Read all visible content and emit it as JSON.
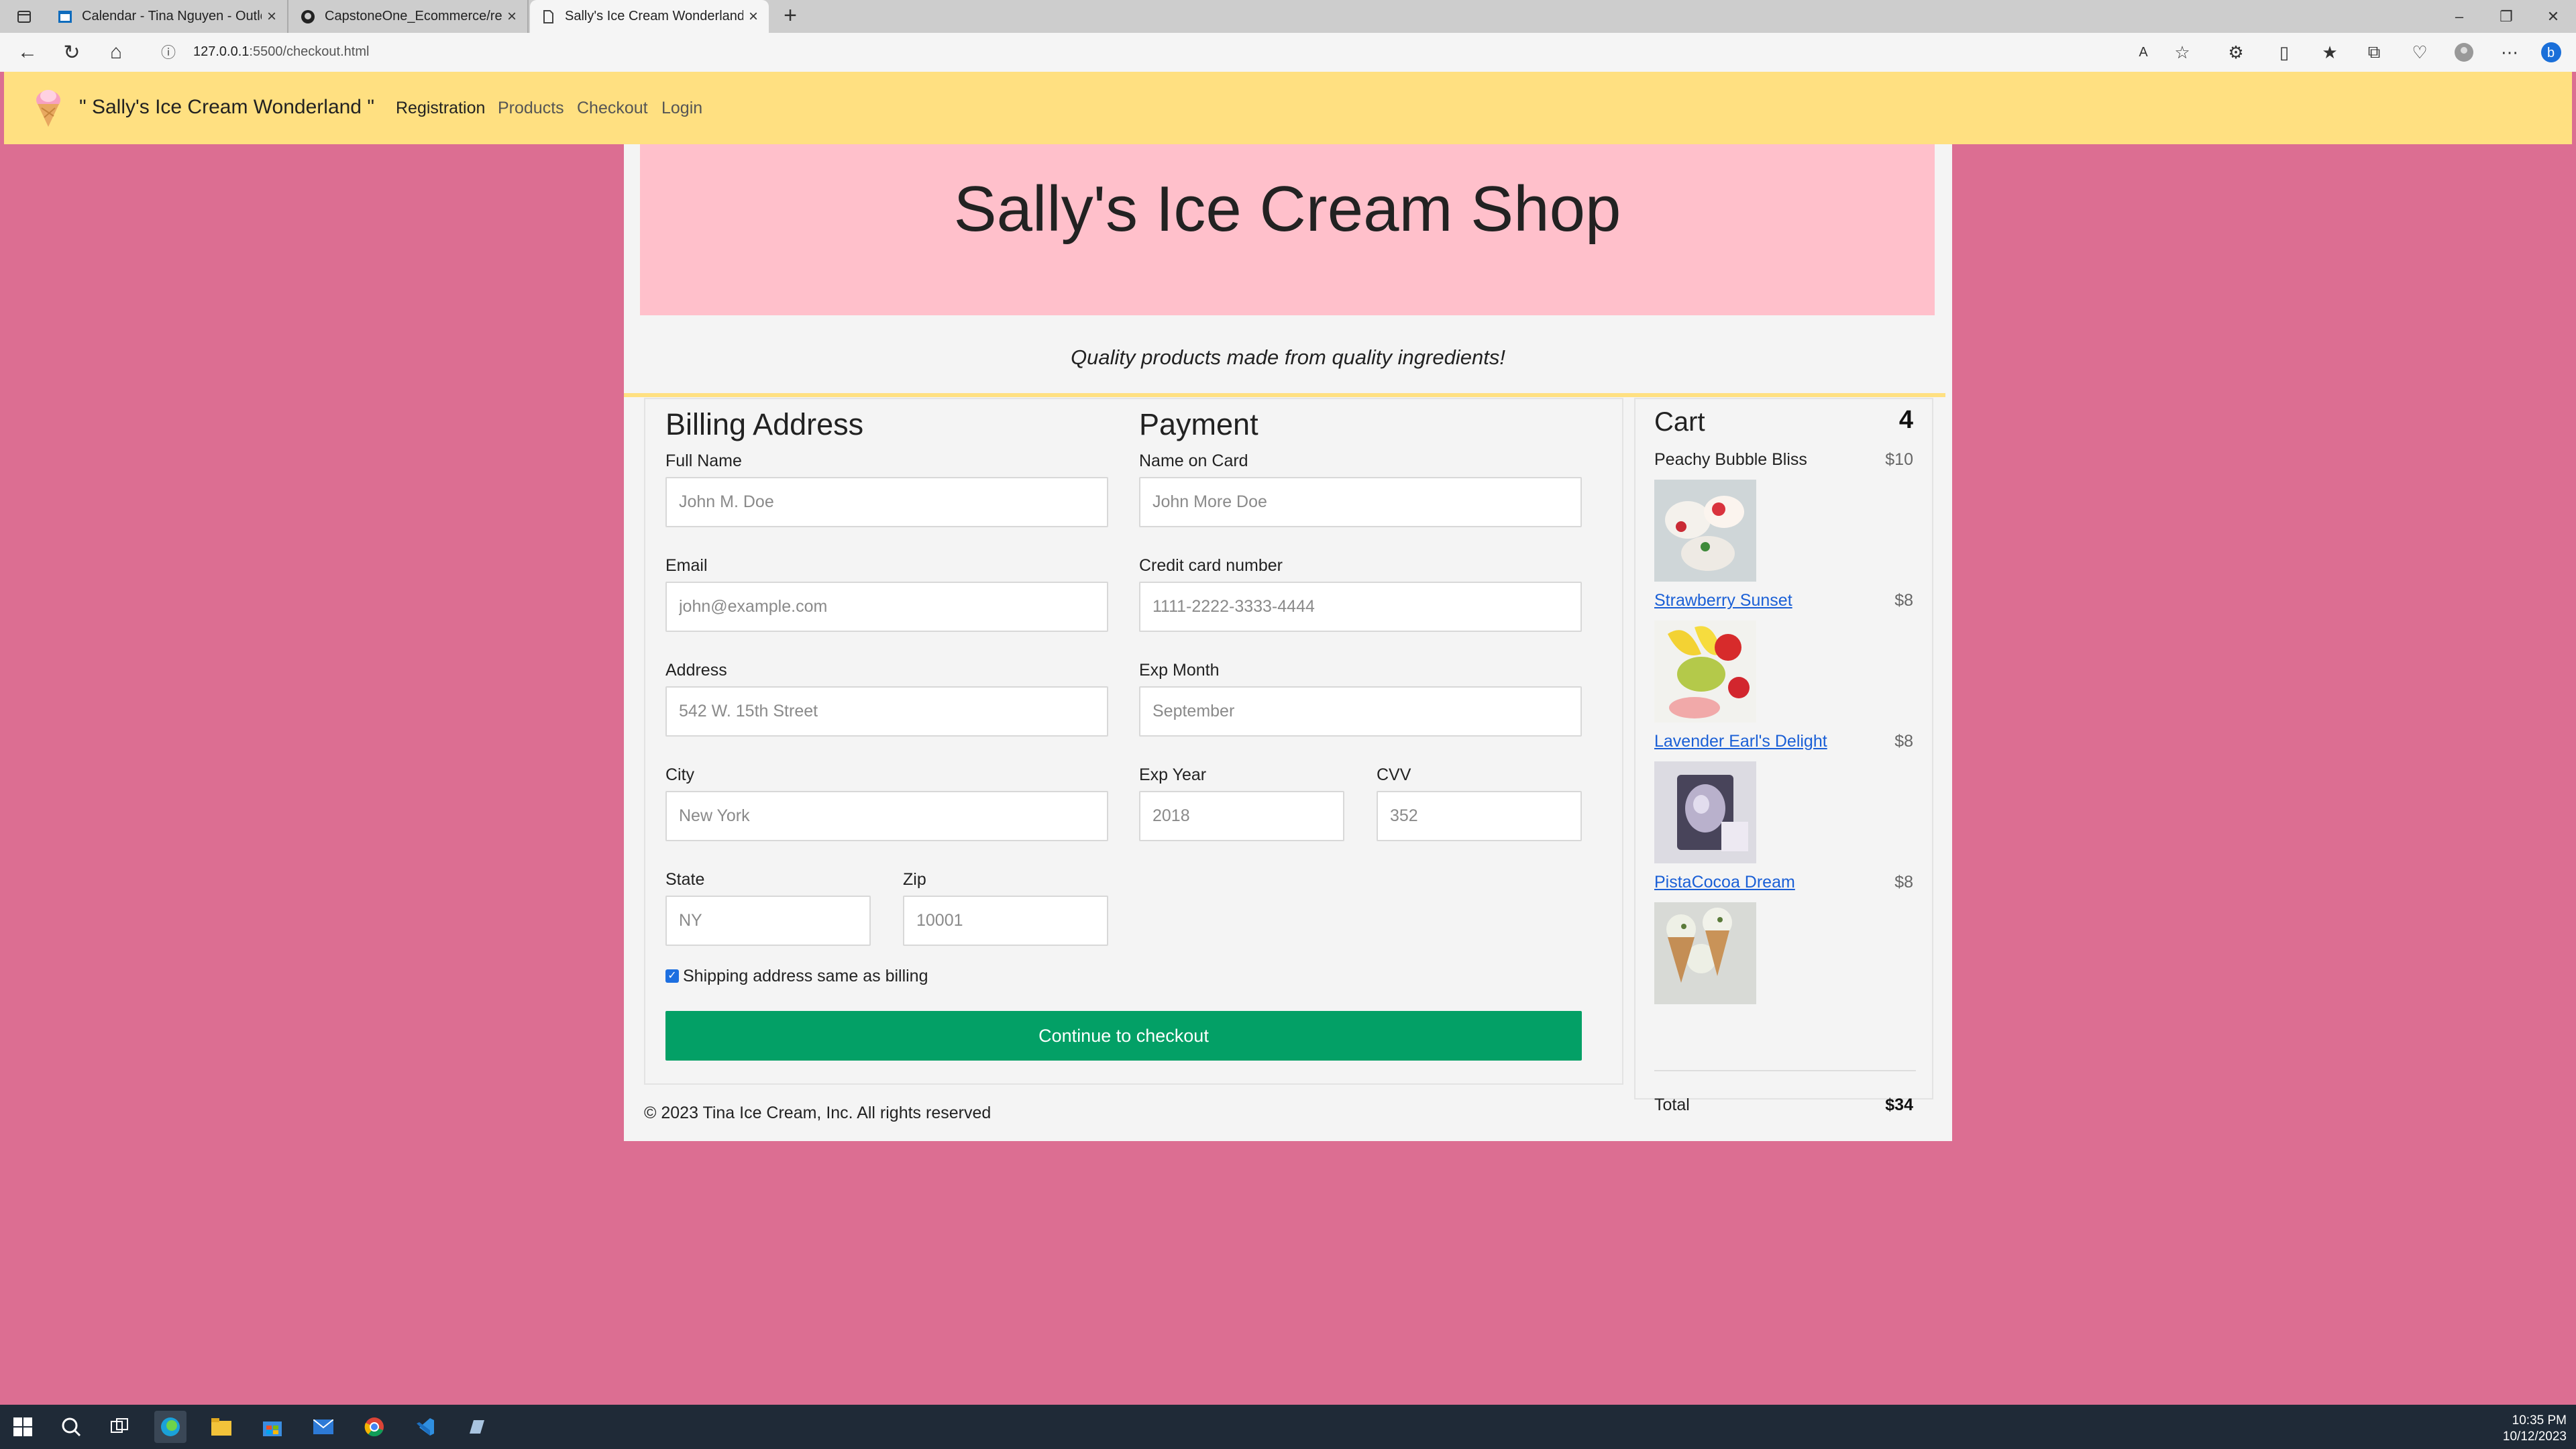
{
  "browser": {
    "tabs": [
      {
        "title": "Calendar - Tina Nguyen - Outlook",
        "icon": "outlook-calendar-icon"
      },
      {
        "title": "CapstoneOne_Ecommerce/readme",
        "icon": "github-icon"
      },
      {
        "title": "Sally's Ice Cream Wonderland!",
        "icon": "page-icon"
      }
    ],
    "url_host": "127.0.0.1",
    "url_rest": ":5500/checkout.html"
  },
  "nav": {
    "brand": "\" Sally's Ice Cream Wonderland \"",
    "links": [
      "Registration",
      "Products",
      "Checkout",
      "Login"
    ]
  },
  "hero": {
    "title": "Sally's Ice Cream Shop",
    "tagline": "Quality products made from quality ingredients!"
  },
  "billing": {
    "heading": "Billing Address",
    "full_name_label": "Full Name",
    "full_name_placeholder": "John M. Doe",
    "email_label": "Email",
    "email_placeholder": "john@example.com",
    "address_label": "Address",
    "address_placeholder": "542 W. 15th Street",
    "city_label": "City",
    "city_placeholder": "New York",
    "state_label": "State",
    "state_placeholder": "NY",
    "zip_label": "Zip",
    "zip_placeholder": "10001"
  },
  "payment": {
    "heading": "Payment",
    "name_label": "Name on Card",
    "name_placeholder": "John More Doe",
    "card_label": "Credit card number",
    "card_placeholder": "1111-2222-3333-4444",
    "exp_month_label": "Exp Month",
    "exp_month_placeholder": "September",
    "exp_year_label": "Exp Year",
    "exp_year_placeholder": "2018",
    "cvv_label": "CVV",
    "cvv_placeholder": "352"
  },
  "form": {
    "same_address_label": "Shipping address same as billing",
    "same_address_checked": true,
    "submit_label": "Continue to checkout"
  },
  "cart": {
    "title": "Cart",
    "count": "4",
    "items": [
      {
        "name": "Peachy Bubble Bliss",
        "price": "$10"
      },
      {
        "name": "Strawberry Sunset",
        "price": "$8"
      },
      {
        "name": "Lavender Earl's Delight",
        "price": "$8"
      },
      {
        "name": "PistaCocoa Dream",
        "price": "$8"
      }
    ],
    "total_label": "Total",
    "total": "$34"
  },
  "footer": "© 2023 Tina Ice Cream, Inc. All rights reserved",
  "taskbar": {
    "time": "10:35 PM",
    "date": "10/12/2023"
  },
  "colors": {
    "page_bg": "#dc6e92",
    "navbar": "#ffe081",
    "hero": "#ffc0cb",
    "button": "#03a066",
    "link": "#1a5fd6"
  }
}
